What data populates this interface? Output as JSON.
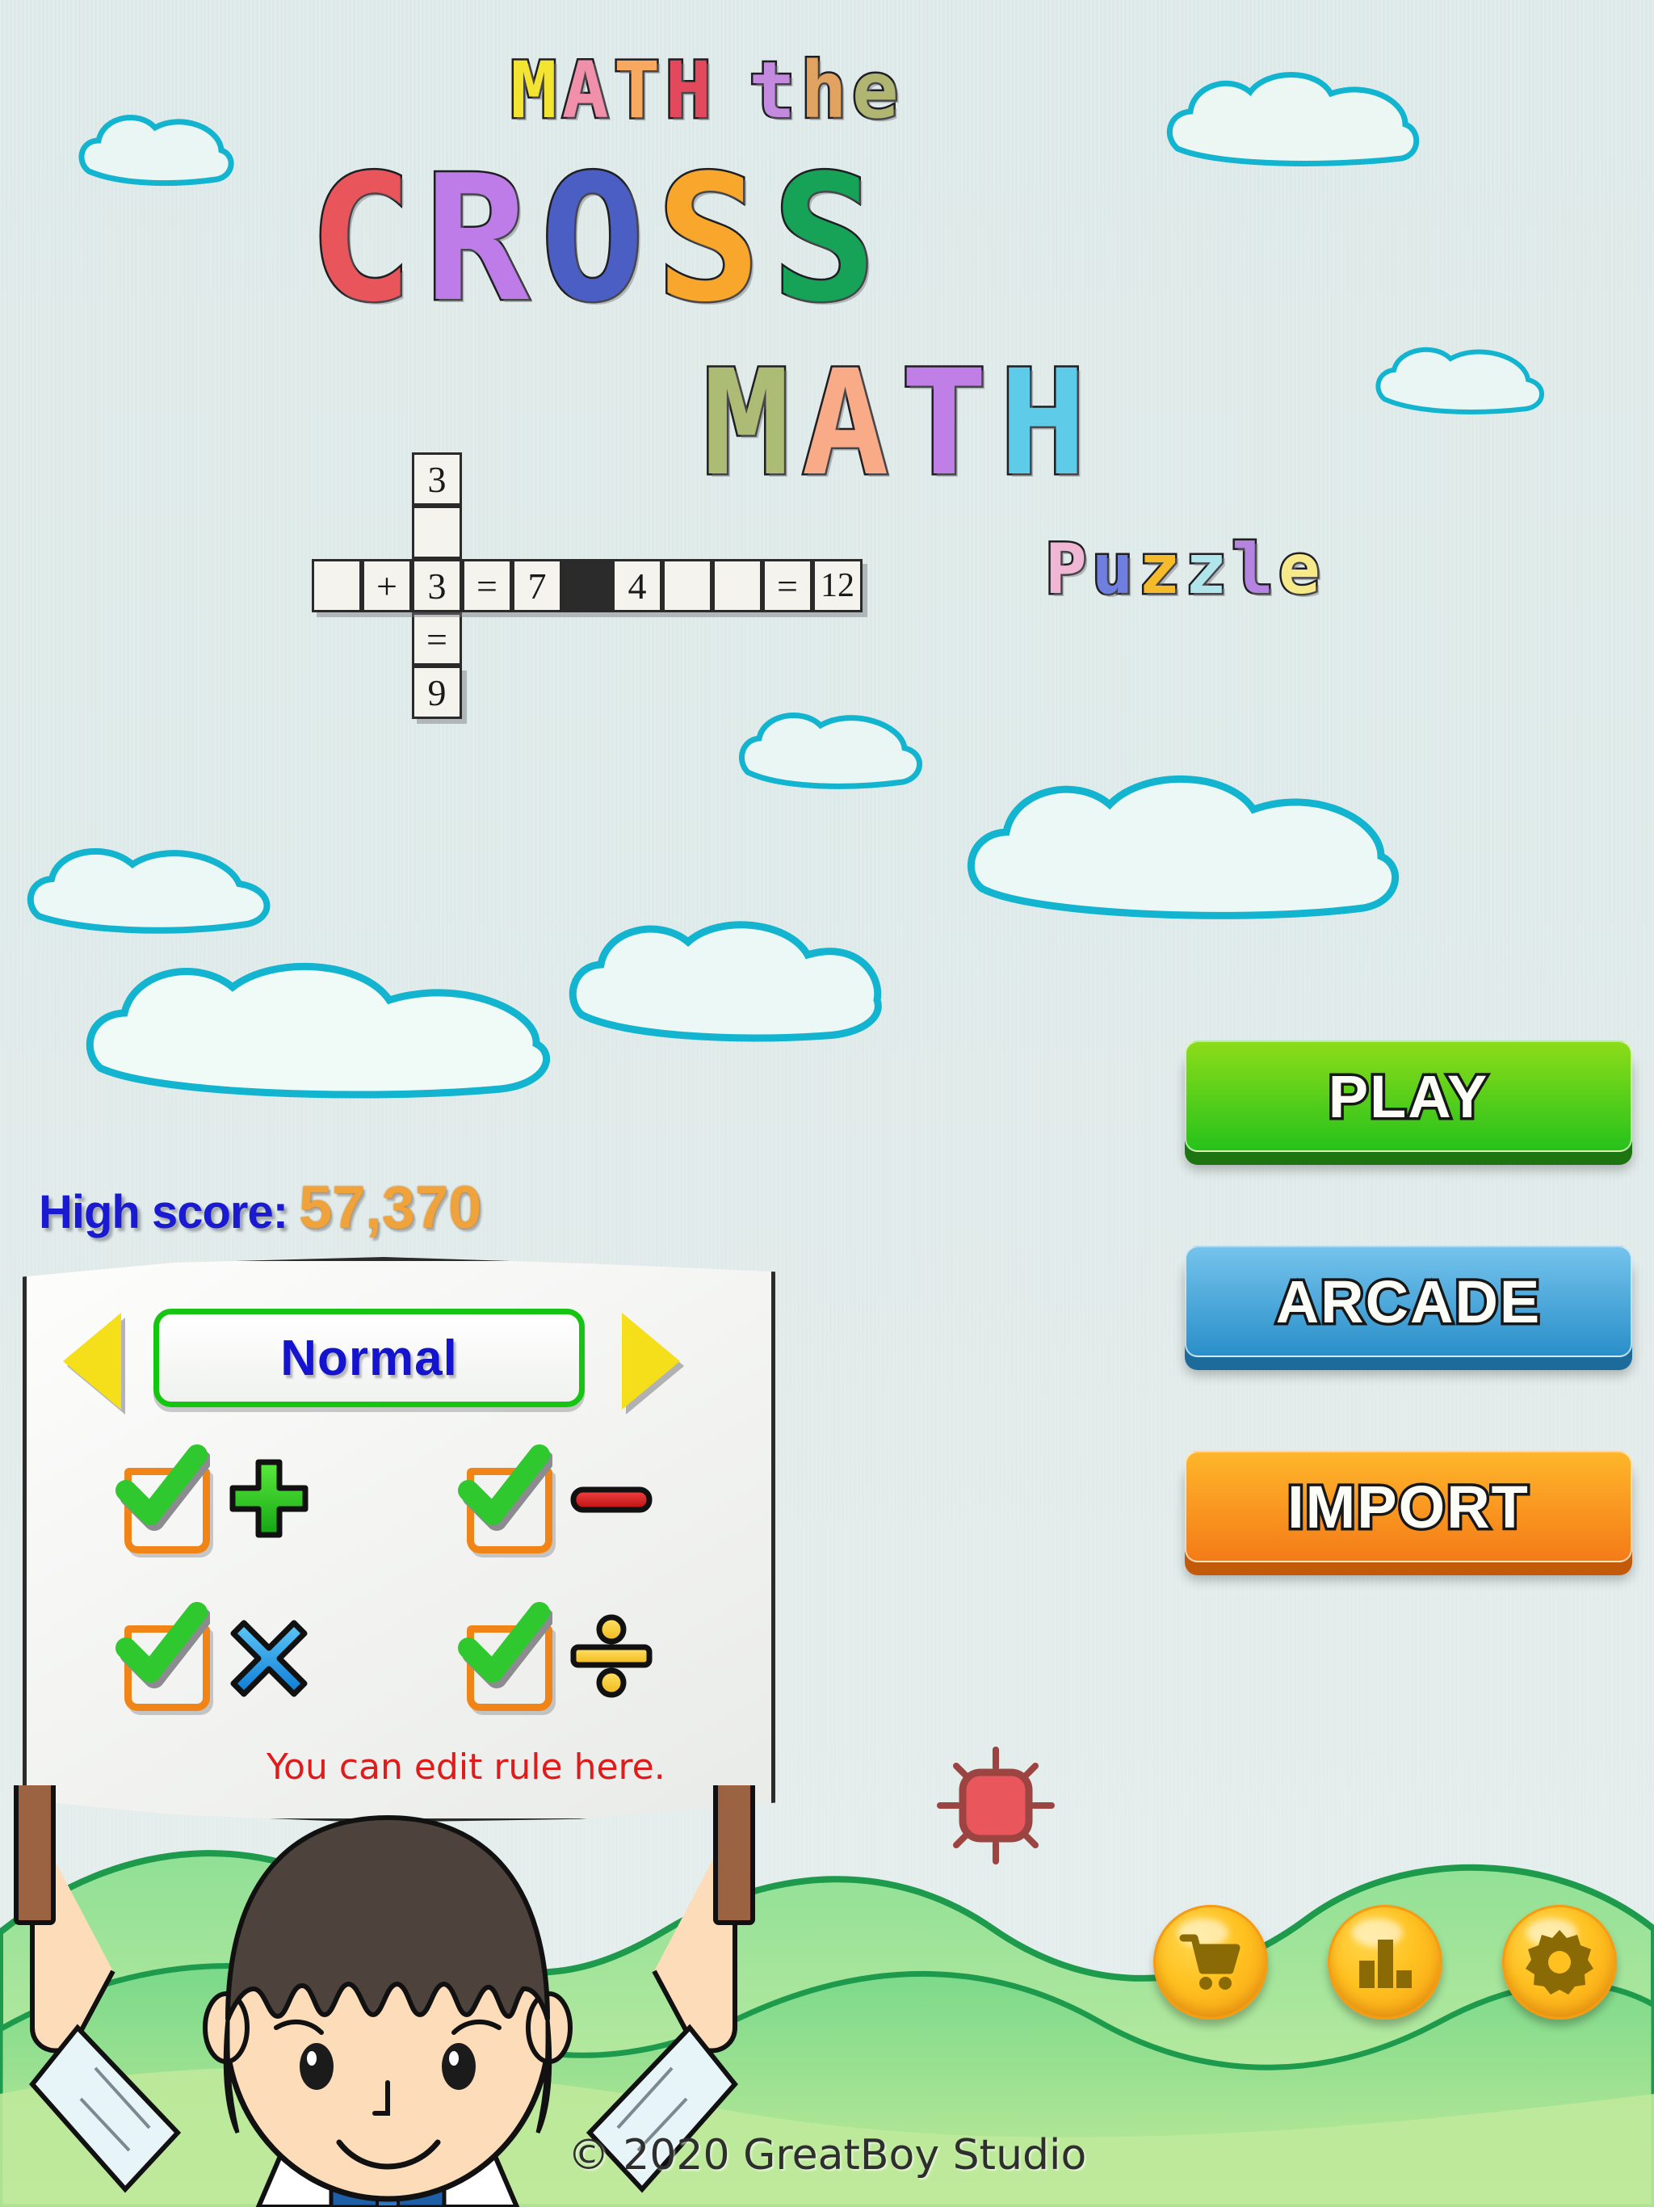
{
  "app": {
    "title_line1": "MATH the",
    "title_line2": "CROSS",
    "title_line3": "MATH",
    "title_line4": "Puzzle",
    "copyright": "© 2020 GreatBoy Studio"
  },
  "logo": {
    "line1_letters": [
      {
        "ch": "M",
        "color": "#f2e431"
      },
      {
        "ch": "A",
        "color": "#f190ab"
      },
      {
        "ch": "T",
        "color": "#f6a95f"
      },
      {
        "ch": "H",
        "color": "#e2495c"
      },
      {
        "ch": "t",
        "color": "#c48ae0"
      },
      {
        "ch": "h",
        "color": "#e1a35f"
      },
      {
        "ch": "e",
        "color": "#b0b572"
      }
    ],
    "line2_letters": [
      {
        "ch": "C",
        "color": "#e8555a"
      },
      {
        "ch": "R",
        "color": "#bd7ce8"
      },
      {
        "ch": "O",
        "color": "#4a5ec4"
      },
      {
        "ch": "S",
        "color": "#f8a72c"
      },
      {
        "ch": "S",
        "color": "#16a257"
      }
    ],
    "line3_letters": [
      {
        "ch": "M",
        "color": "#adbc74"
      },
      {
        "ch": "A",
        "color": "#f9ab87"
      },
      {
        "ch": "T",
        "color": "#c07fe6"
      },
      {
        "ch": "H",
        "color": "#5ecbe8"
      }
    ],
    "line4_letters": [
      {
        "ch": "P",
        "color": "#f0b7d4"
      },
      {
        "ch": "u",
        "color": "#6f7fe0"
      },
      {
        "ch": "z",
        "color": "#f6bb2b"
      },
      {
        "ch": "z",
        "color": "#b0e5ec"
      },
      {
        "ch": "l",
        "color": "#b583e0"
      },
      {
        "ch": "e",
        "color": "#f5e98a"
      }
    ]
  },
  "crossword": {
    "across_row": [
      "",
      "+",
      "3",
      "=",
      "7",
      "BLACK",
      "4",
      "",
      "",
      "=",
      "12"
    ],
    "down_col": [
      "3",
      "",
      "3",
      "=",
      "9"
    ],
    "black_index": 5
  },
  "high_score": {
    "label": "High score:",
    "value": "57,370",
    "label_color": "#1a1ad0",
    "value_color": "#f0a33a"
  },
  "rule_board": {
    "prev_arrow": "triangle-left-icon",
    "next_arrow": "triangle-right-icon",
    "difficulty": "Normal",
    "difficulty_border_color": "#16c412",
    "difficulty_text_color": "#1414cf",
    "rules": [
      {
        "name": "addition",
        "symbol": "+",
        "checked": true,
        "color": "#2fc82f"
      },
      {
        "name": "subtraction",
        "symbol": "−",
        "checked": true,
        "color": "#e01f1f"
      },
      {
        "name": "multiplication",
        "symbol": "×",
        "checked": true,
        "color": "#27a8ef"
      },
      {
        "name": "division",
        "symbol": "÷",
        "checked": true,
        "color": "#f5c52a"
      }
    ],
    "hint": "You can edit rule here.",
    "hint_color": "#e01b1b"
  },
  "main_buttons": [
    {
      "label": "PLAY",
      "color": "#27c21b",
      "name": "play-button"
    },
    {
      "label": "ARCADE",
      "color": "#2a8fca",
      "name": "arcade-button"
    },
    {
      "label": "IMPORT",
      "color": "#f47b17",
      "name": "import-button"
    }
  ],
  "icon_buttons": [
    {
      "icon": "shopping-cart-icon",
      "name": "shop-button"
    },
    {
      "icon": "bar-chart-icon",
      "name": "leaderboard-button"
    },
    {
      "icon": "gear-icon",
      "name": "settings-button"
    }
  ],
  "decor": {
    "sun_color": "#e9565c",
    "cloud_outline": "#12b4d0",
    "hill_color": "#8fe096"
  }
}
